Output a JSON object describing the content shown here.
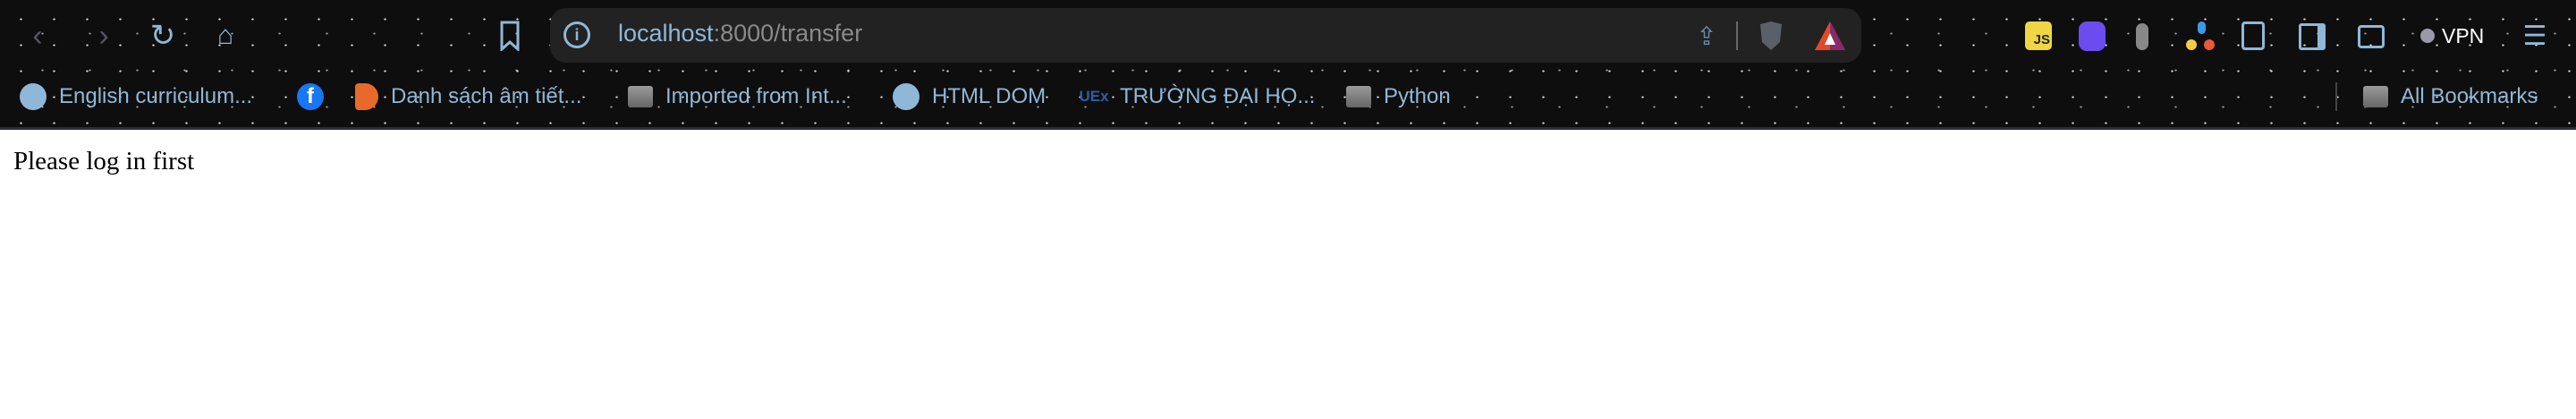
{
  "toolbar": {
    "url_host": "localhost",
    "url_rest": ":8000/transfer",
    "vpn_label": "VPN"
  },
  "extensions": [
    "js-extension",
    "purple-extension",
    "bug-extension",
    "dots-extension"
  ],
  "bookmarks": [
    {
      "label": "English curriculum...",
      "icon": "globe-icon"
    },
    {
      "label": "",
      "icon": "facebook-icon"
    },
    {
      "label": "Danh sách âm tiết...",
      "icon": "orange-play-icon"
    },
    {
      "label": "Imported from Int...",
      "icon": "folder-icon"
    },
    {
      "label": "HTML DOM",
      "icon": "globe-icon"
    },
    {
      "label": "TRƯỜNG ĐẠI HỌ...",
      "icon": "uex-icon",
      "icon_text": "UEx"
    },
    {
      "label": "Python",
      "icon": "folder-icon"
    }
  ],
  "all_bookmarks": "All Bookmarks",
  "page": {
    "message": "Please log in first"
  },
  "colors": {
    "toolbar_bg": "#0e0e0e",
    "accent": "#8fb8d8"
  }
}
